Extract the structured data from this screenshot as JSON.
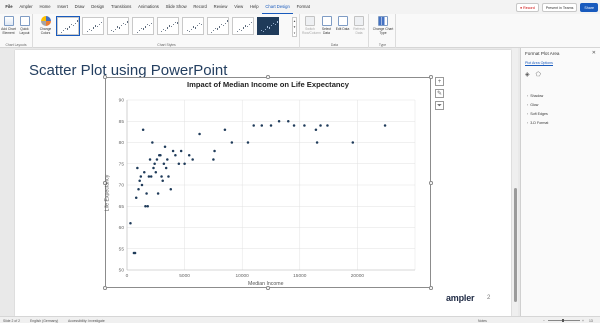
{
  "ribbon": {
    "tabs": [
      "File",
      "Ampler",
      "Home",
      "Insert",
      "Draw",
      "Design",
      "Transitions",
      "Animations",
      "Slide Show",
      "Record",
      "Review",
      "View",
      "Help",
      "Chart Design",
      "Format"
    ],
    "active_tab": "Chart Design",
    "record_label": "Record",
    "present_label": "Present in Teams",
    "share_label": "Share",
    "groups": {
      "layouts": {
        "label": "Chart Layouts",
        "add_element": "Add Chart Element",
        "quick_layout": "Quick Layout"
      },
      "styles": {
        "label": "Chart Styles",
        "change_colors": "Change Colors"
      },
      "data": {
        "label": "Data",
        "switch": "Switch Row/Column",
        "select": "Select Data",
        "edit": "Edit Data",
        "refresh": "Refresh Data"
      },
      "type": {
        "label": "Type",
        "change": "Change Chart Type"
      }
    }
  },
  "slide": {
    "title": "Scatter Plot using PowerPoint",
    "brand": "ampler",
    "number": "2"
  },
  "chart_data": {
    "type": "scatter",
    "title": "Impact of Median Income on Life Expectancy",
    "xlabel": "Median Income",
    "ylabel": "Life Expectancy",
    "xlim": [
      0,
      25000
    ],
    "ylim": [
      50,
      90
    ],
    "xticks": [
      0,
      5000,
      10000,
      15000,
      20000
    ],
    "yticks": [
      50,
      55,
      60,
      65,
      70,
      75,
      80,
      85,
      90
    ],
    "grid": true,
    "marker_color": "#1f3b5a",
    "series": [
      {
        "x": [
          300,
          600,
          700,
          800,
          900,
          1000,
          1100,
          1200,
          1300,
          1400,
          1500,
          1600,
          1700,
          1800,
          1900,
          2000,
          2100,
          2200,
          2300,
          2400,
          2500,
          2600,
          2700,
          2800,
          2900,
          3000,
          3100,
          3200,
          3300,
          3400,
          3500,
          3600,
          3800,
          4000,
          4200,
          4500,
          4700,
          5000,
          5400,
          5700,
          6300,
          7500,
          7600,
          8500,
          9100,
          10500,
          11000,
          11700,
          12500,
          13200,
          14000,
          14500,
          15400,
          16400,
          16500,
          16800,
          17400,
          19600,
          22400
        ],
        "y": [
          61,
          54,
          54,
          67,
          74,
          69,
          71,
          72,
          70,
          83,
          73,
          65,
          68,
          65,
          72,
          76,
          72,
          80,
          74,
          75,
          73,
          76,
          68,
          77,
          77,
          72,
          71,
          75,
          79,
          74,
          76,
          72,
          69,
          78,
          77,
          75,
          78,
          75,
          77,
          76,
          82,
          76,
          78,
          83,
          80,
          80,
          84,
          84,
          84,
          85,
          85,
          84,
          84,
          83,
          80,
          84,
          84,
          80,
          84
        ]
      }
    ]
  },
  "pane": {
    "title": "Format Plot Area",
    "tab": "Plot Area Options",
    "sections": [
      "Shadow",
      "Glow",
      "Soft Edges",
      "3-D Format"
    ]
  },
  "status": {
    "slide_info": "Slide 2 of 2",
    "language": "English (Germany)",
    "accessibility": "Accessibility: Investigate",
    "notes": "Notes",
    "zoom": "13"
  },
  "colors": {
    "accent": "#185abd",
    "title_text": "#243f60",
    "marker": "#1f3b5a"
  }
}
